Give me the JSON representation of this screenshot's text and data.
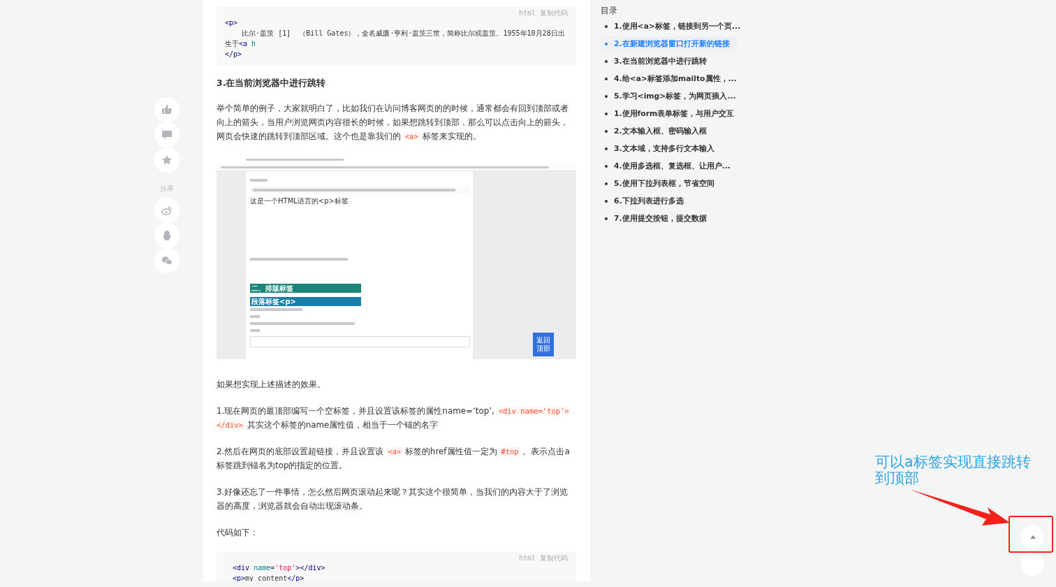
{
  "side_actions": {
    "items": [
      {
        "kind": "like"
      },
      {
        "kind": "comment"
      },
      {
        "kind": "star"
      },
      {
        "kind": "label",
        "text": "分享"
      },
      {
        "kind": "weibo"
      },
      {
        "kind": "qq"
      },
      {
        "kind": "wechat"
      }
    ]
  },
  "article": {
    "blocks": [
      {
        "kind": "code",
        "lang": "html",
        "copy": "复制代码",
        "indented": false,
        "lines": [
          [
            {
              "kind": "tag",
              "text": "<p>"
            }
          ],
          [
            {
              "kind": "text",
              "text": "    比尔·盖茨 [1]  （Bill Gates），全名威廉·亨利·盖茨三世，简称比尔或盖茨。1955年10月28日出生于"
            },
            {
              "kind": "tag",
              "text": "<a"
            },
            {
              "kind": "attr",
              "text": "h"
            }
          ],
          [
            {
              "kind": "tag",
              "text": "</p>"
            }
          ]
        ]
      },
      {
        "kind": "heading",
        "text": "3.在当前浏览器中进行跳转"
      },
      {
        "kind": "paragraph",
        "parts": [
          {
            "kind": "text",
            "text": "举个简单的例子，大家就明白了，比如我们在访问博客网页的的时候，通常都会有回到顶部或者向上的箭头，当用户浏览网页内容很长的时候，如果想跳转到顶部，那么可以点击向上的箭头，网页会快速的跳转到顶部区域。这个也是靠我们的 "
          },
          {
            "kind": "code",
            "text": "<a>"
          },
          {
            "kind": "text",
            "text": " 标签来实现的。"
          }
        ]
      },
      {
        "kind": "screenshot",
        "paragraph_text": "这是一个HTML语言的<p>标签",
        "heading": "二、排版标签",
        "subheading": "段落标签<p>",
        "back_to_top": "返回顶部"
      },
      {
        "kind": "paragraph",
        "parts": [
          {
            "kind": "text",
            "text": "如果想实现上述描述的效果。"
          }
        ]
      },
      {
        "kind": "paragraph",
        "parts": [
          {
            "kind": "text",
            "text": "1.现在网页的最顶部编写一个空标签，并且设置该标签的属性name=‘top’, "
          },
          {
            "kind": "code",
            "text": "<div name='top'></div>"
          },
          {
            "kind": "text",
            "text": " 其实这个标签的name属性值，相当于一个锚的名字"
          }
        ]
      },
      {
        "kind": "paragraph",
        "parts": [
          {
            "kind": "text",
            "text": "2.然后在网页的底部设置超链接，并且设置该 "
          },
          {
            "kind": "code",
            "text": "<a>"
          },
          {
            "kind": "text",
            "text": " 标签的href属性值一定为 "
          },
          {
            "kind": "code",
            "text": "#top"
          },
          {
            "kind": "text",
            "text": " 。表示点击a标签跳到锚名为top的指定的位置。"
          }
        ]
      },
      {
        "kind": "paragraph",
        "parts": [
          {
            "kind": "text",
            "text": "3.好像还忘了一件事情，怎么然后网页滚动起来呢？其实这个很简单，当我们的内容大于了浏览器的高度，浏览器就会自动出现滚动条。"
          }
        ]
      },
      {
        "kind": "paragraph",
        "parts": [
          {
            "kind": "text",
            "text": "代码如下："
          }
        ]
      },
      {
        "kind": "code",
        "lang": "html",
        "copy": "复制代码",
        "indented": true,
        "lines": [
          [
            {
              "kind": "tag",
              "text": "<div"
            },
            {
              "kind": "attr",
              "text": "name"
            },
            {
              "kind": "text",
              "text": "="
            },
            {
              "kind": "string",
              "text": "'top'"
            },
            {
              "kind": "tag",
              "text": "></div>"
            }
          ],
          [
            {
              "kind": "tag",
              "text": "<p>"
            },
            {
              "kind": "text",
              "text": "my content"
            },
            {
              "kind": "tag",
              "text": "</p>"
            }
          ]
        ]
      }
    ]
  },
  "toc": {
    "title": "目录",
    "items": [
      {
        "text": "1.使用<a>标签，链接到另一个页...",
        "selected": false
      },
      {
        "text": "2.在新建浏览器窗口打开新的链接",
        "selected": true
      },
      {
        "text": "3.在当前浏览器中进行跳转",
        "selected": false
      },
      {
        "text": "4.给<a>标签添加mailto属性，...",
        "selected": false
      },
      {
        "text": "5.学习<img>标签，为网页插入...",
        "selected": false
      },
      {
        "text": "1.使用form表单标签，与用户交互",
        "selected": false
      },
      {
        "text": "2.文本输入框、密码输入框",
        "selected": false
      },
      {
        "text": "3.文本域，支持多行文本输入",
        "selected": false
      },
      {
        "text": "4.使用多选框、复选框、让用户...",
        "selected": false
      },
      {
        "text": "5.使用下拉列表框，节省空间",
        "selected": false
      },
      {
        "text": "6.下拉列表进行多选",
        "selected": false
      },
      {
        "text": "7.使用提交按钮，提交数据",
        "selected": false
      }
    ]
  },
  "floating_buttons": [
    {
      "kind": "scroll_top"
    },
    {
      "kind": "plain"
    }
  ],
  "annotation": {
    "text": "可以a标签实现直接跳转到顶部"
  }
}
